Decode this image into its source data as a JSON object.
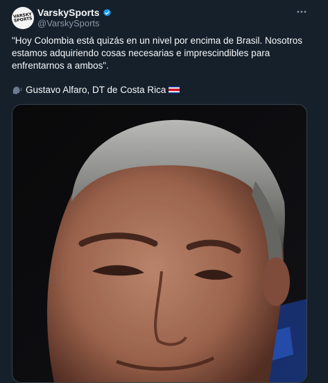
{
  "tweet": {
    "author_name": "VarskySports",
    "handle": "@VarskySports",
    "avatar_text": "VARSKY SPORTS",
    "text": "\"Hoy Colombia está quizás en un nivel por encima de Brasil. Nosotros estamos adquiriendo cosas necesarias e imprescindibles para enfrentarnos a ambos\".",
    "attribution": "Gustavo Alfaro, DT de Costa Rica",
    "attribution_icon": "speaking-head-icon",
    "flag": "costa-rica-flag-icon",
    "verified_icon": "verified-badge-icon",
    "more_icon": "more-icon"
  },
  "colors": {
    "background": "#15202b",
    "verified": "#1d9bf0",
    "secondary_text": "#8b98a5"
  }
}
